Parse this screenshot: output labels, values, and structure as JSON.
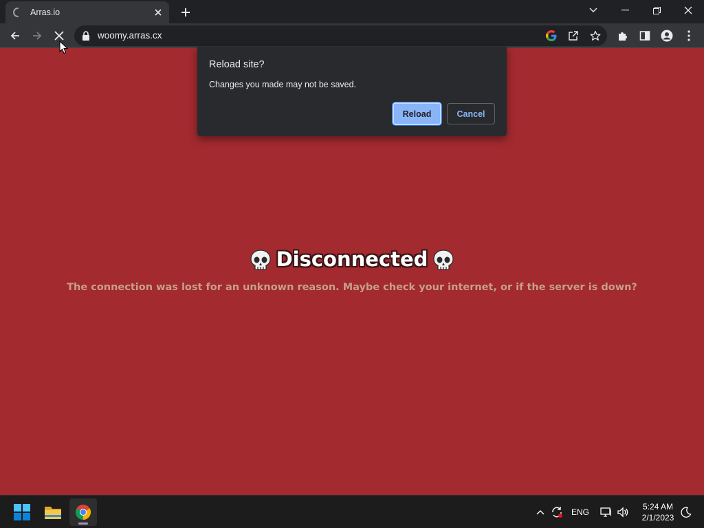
{
  "browser": {
    "tab": {
      "title": "Arras.io",
      "loading": true
    },
    "url": "woomy.arras.cx",
    "icons": {
      "back": "arrow-left-icon",
      "forward": "arrow-right-icon",
      "stop": "close-icon",
      "lock": "lock-icon",
      "google": "google-icon",
      "share": "share-icon",
      "bookmark": "star-icon",
      "extensions": "puzzle-icon",
      "sidepanel": "side-panel-icon",
      "profile": "profile-icon",
      "menu": "kebab-menu-icon"
    }
  },
  "dialog": {
    "title": "Reload site?",
    "message": "Changes you made may not be saved.",
    "reload_label": "Reload",
    "cancel_label": "Cancel"
  },
  "page": {
    "heading": "Disconnected",
    "heading_icon": "skull-icon",
    "message": "The connection was lost for an unknown reason. Maybe check your internet, or if the server is down?",
    "background_color": "#a32a2f"
  },
  "taskbar": {
    "lang": "ENG",
    "time": "5:24 AM",
    "date": "2/1/2023",
    "apps": [
      "start-icon",
      "file-explorer-icon",
      "chrome-icon"
    ]
  },
  "colors": {
    "accent": "#8ab4f8",
    "dialog_bg": "#292a2d",
    "chrome_dark": "#202124"
  }
}
